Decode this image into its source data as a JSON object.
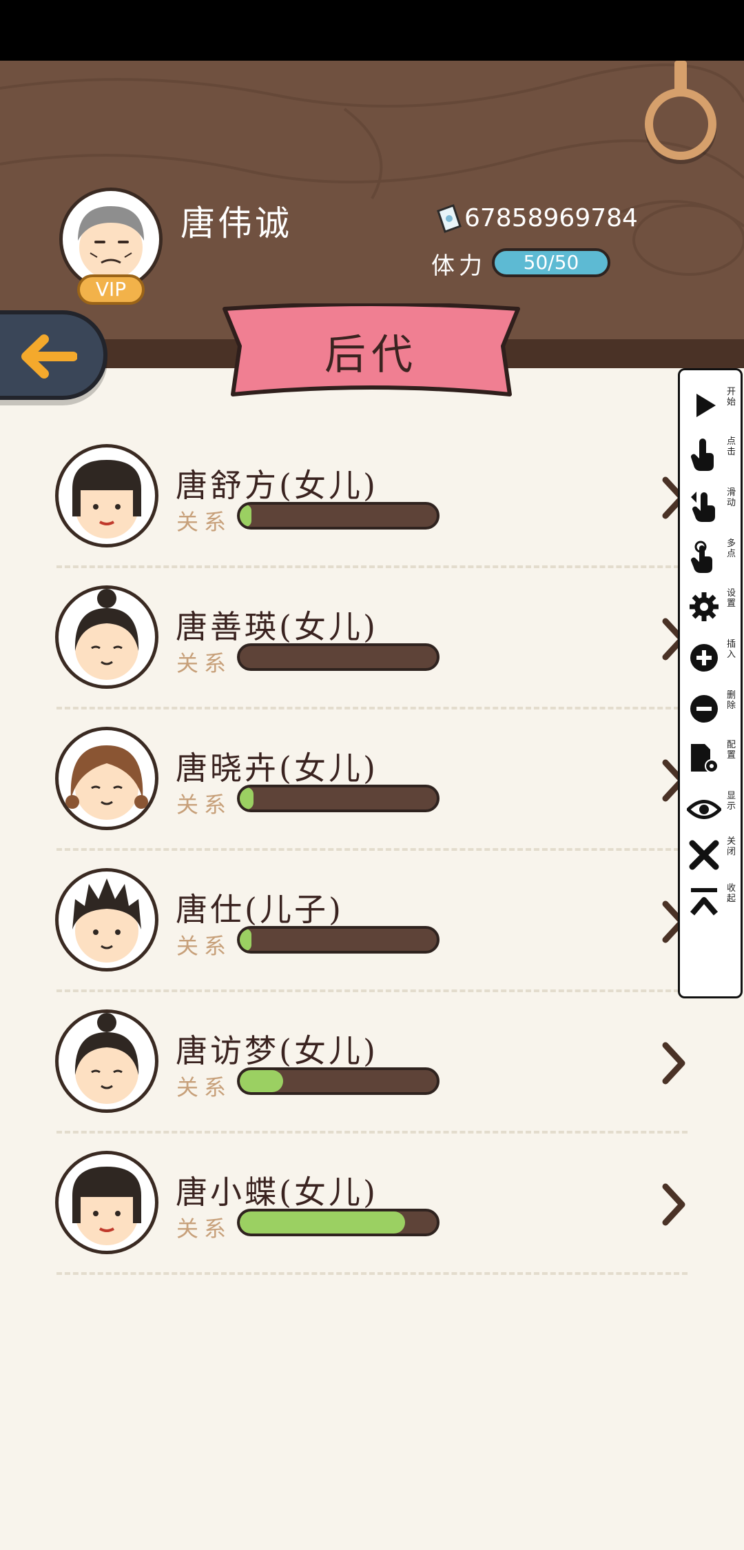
{
  "header": {
    "player_name": "唐伟诚",
    "vip_label": "VIP",
    "currency": "67858969784",
    "stamina_label": "体力",
    "stamina_value": "50/50",
    "page_title": "后代"
  },
  "descendants": [
    {
      "name": "唐舒方(女儿)",
      "relation_label": "关系",
      "relation_level": 0.02,
      "avatar": "girl-bangs-icon",
      "has_arrow": true
    },
    {
      "name": "唐善瑛(女儿)",
      "relation_label": "关系",
      "relation_level": 0.0,
      "avatar": "girl-bun-icon",
      "has_arrow": true
    },
    {
      "name": "唐晓卉(女儿)",
      "relation_label": "关系",
      "relation_level": 0.07,
      "avatar": "girl-brown-hair-icon",
      "has_arrow": true
    },
    {
      "name": "唐仕(儿子)",
      "relation_label": "关系",
      "relation_level": 0.06,
      "avatar": "boy-spiky-hair-icon",
      "has_arrow": true
    },
    {
      "name": "唐访梦(女儿)",
      "relation_label": "关系",
      "relation_level": 0.22,
      "avatar": "girl-bun-icon",
      "has_arrow": true
    },
    {
      "name": "唐小蝶(女儿)",
      "relation_label": "关系",
      "relation_level": 0.84,
      "avatar": "girl-bangs-icon",
      "has_arrow": true
    }
  ],
  "toolbar": [
    {
      "label": "开始",
      "icon": "play-icon"
    },
    {
      "label": "点击",
      "icon": "tap-hand-icon"
    },
    {
      "label": "滑动",
      "icon": "swipe-hand-icon"
    },
    {
      "label": "多点",
      "icon": "multi-touch-icon"
    },
    {
      "label": "设置",
      "icon": "gear-icon"
    },
    {
      "label": "插入",
      "icon": "plus-circle-icon"
    },
    {
      "label": "删除",
      "icon": "minus-circle-icon"
    },
    {
      "label": "配置",
      "icon": "config-file-icon"
    },
    {
      "label": "显示",
      "icon": "eye-icon"
    },
    {
      "label": "关闭",
      "icon": "close-icon"
    },
    {
      "label": "收起",
      "icon": "collapse-icon"
    }
  ],
  "colors": {
    "header_wood": "#705140",
    "banner_pink": "#f07f92",
    "bar_fill_green": "#9bd062",
    "stamina_blue": "#5dbad3",
    "back_button": "#3a4658",
    "arrow_orange": "#f4a92c"
  }
}
